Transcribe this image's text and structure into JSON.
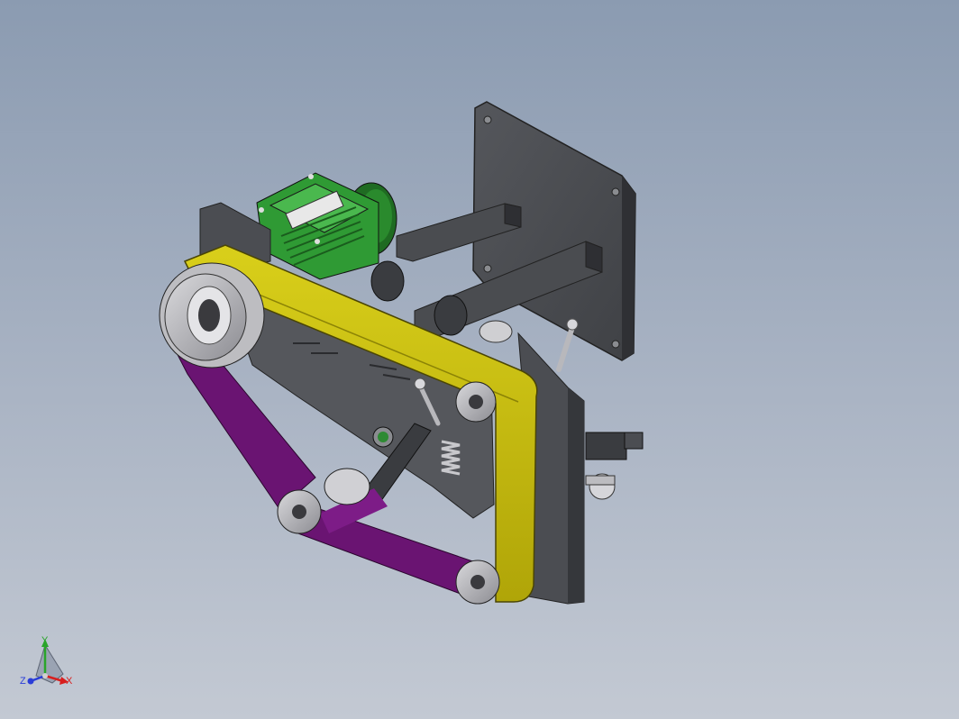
{
  "viewport": {
    "triad": {
      "x_label": "X",
      "y_label": "Y",
      "z_label": "Z"
    }
  },
  "colors": {
    "background_top": "#8b9bb1",
    "background_bottom": "#c3c9d3",
    "frame": "#4b4d52",
    "belt_yellow": "#c7bd0c",
    "belt_purple": "#6a1472",
    "motor_green": "#2f9a34",
    "steel": "#b8b8bc",
    "x_axis": "#d81e1e",
    "y_axis": "#2aa52a",
    "z_axis": "#2a3dd8"
  }
}
